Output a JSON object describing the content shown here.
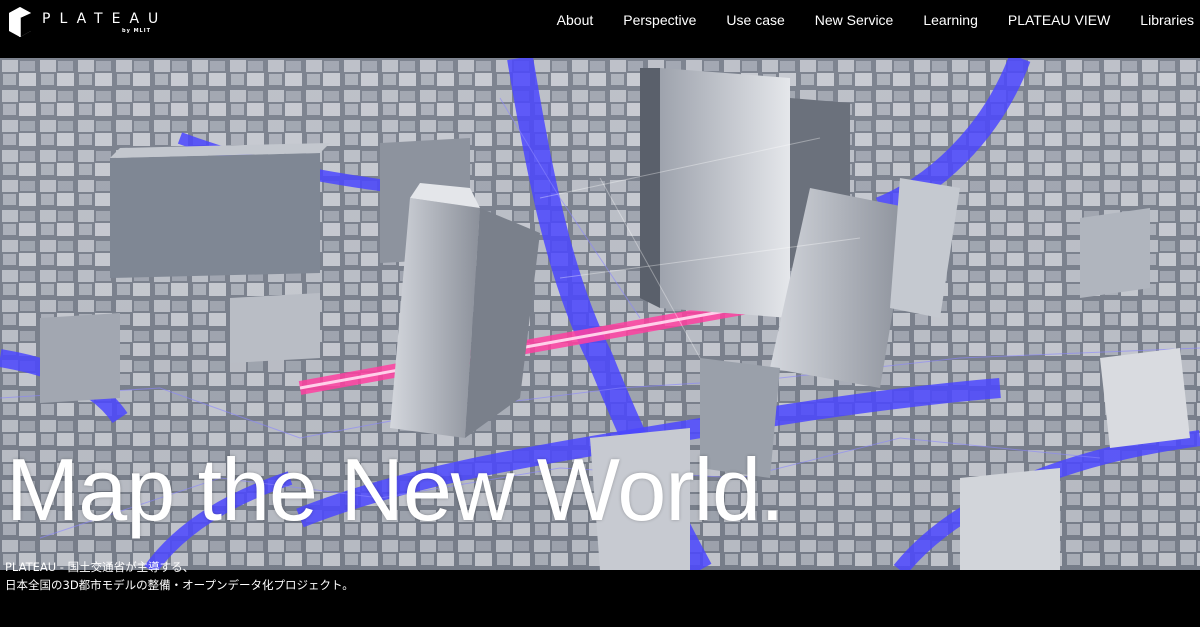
{
  "brand": {
    "name": "PLATEAU",
    "byline": "by MLIT"
  },
  "nav": {
    "items": [
      "About",
      "Perspective",
      "Use case",
      "New Service",
      "Learning",
      "PLATEAU VIEW",
      "Libraries"
    ]
  },
  "hero": {
    "headline": "Map the New World.",
    "caption_line1": "PLATEAU - 国土交通省が主導する、",
    "caption_line2": "日本全国の3D都市モデルの整備・オープンデータ化プロジェクト。"
  },
  "colors": {
    "background": "#000000",
    "text": "#ffffff",
    "accent_blue": "#3b3bff",
    "accent_pink": "#ff3fa0"
  }
}
